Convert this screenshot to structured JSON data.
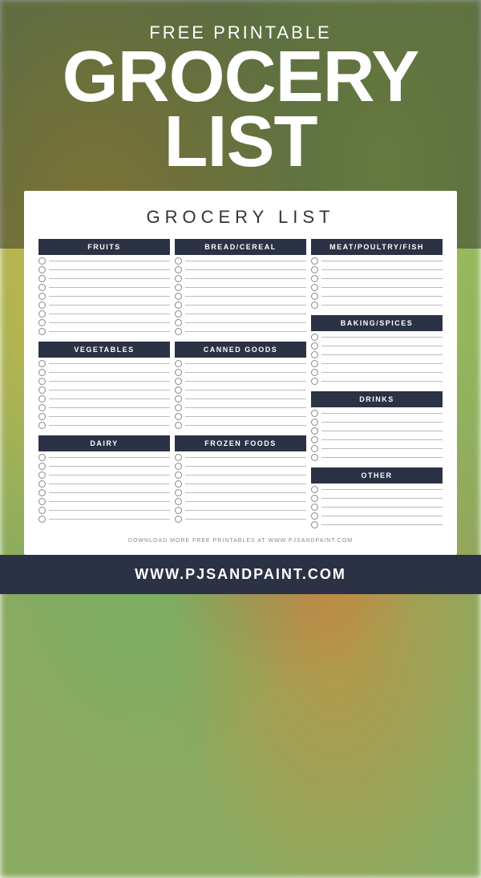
{
  "header": {
    "subtitle": "Free Printable",
    "title_line1": "GROCERY",
    "title_line2": "LIST"
  },
  "card": {
    "title": "GROCERY LIST",
    "sections": {
      "col1": [
        {
          "label": "FRUITS",
          "lines": 9
        },
        {
          "spacer": true
        },
        {
          "label": "VEGETABLES",
          "lines": 8
        },
        {
          "spacer": true
        },
        {
          "label": "DAIRY",
          "lines": 8
        }
      ],
      "col2": [
        {
          "label": "BREAD/CEREAL",
          "lines": 9
        },
        {
          "spacer": true
        },
        {
          "label": "CANNED GOODS",
          "lines": 8
        },
        {
          "spacer": true
        },
        {
          "label": "FROZEN FOODS",
          "lines": 8
        }
      ],
      "col3": [
        {
          "label": "MEAT/POULTRY/FISH",
          "lines": 6
        },
        {
          "spacer": true
        },
        {
          "label": "BAKING/SPICES",
          "lines": 6
        },
        {
          "spacer": true
        },
        {
          "label": "DRINKS",
          "lines": 6
        },
        {
          "spacer": true
        },
        {
          "label": "OTHER",
          "lines": 5
        }
      ]
    },
    "footer": "DOWNLOAD MORE FREE PRINTABLES AT WWW.PJSANDPAINT.COM"
  },
  "bottom_bar": {
    "text": "WWW.PJSANDPAINT.COM"
  }
}
